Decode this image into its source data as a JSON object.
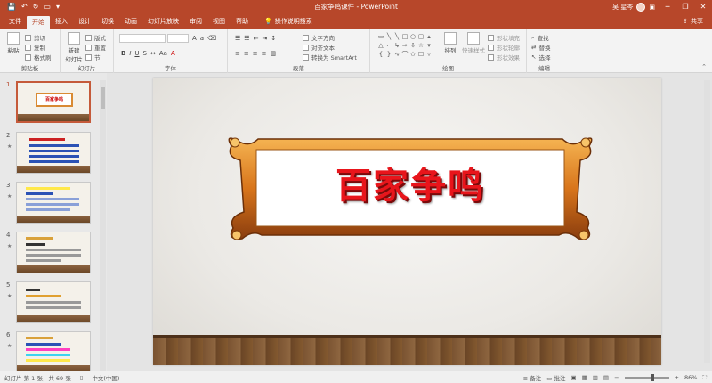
{
  "window": {
    "title": "百家争鸣课件 - PowerPoint",
    "user": "吴 星岑",
    "share": "共享"
  },
  "tabs": [
    {
      "label": "文件",
      "active": false
    },
    {
      "label": "开始",
      "active": true
    },
    {
      "label": "插入",
      "active": false
    },
    {
      "label": "设计",
      "active": false
    },
    {
      "label": "切换",
      "active": false
    },
    {
      "label": "动画",
      "active": false
    },
    {
      "label": "幻灯片放映",
      "active": false
    },
    {
      "label": "审阅",
      "active": false
    },
    {
      "label": "视图",
      "active": false
    },
    {
      "label": "帮助",
      "active": false
    }
  ],
  "tell_me": "操作说明搜索",
  "ribbon": {
    "clipboard": {
      "label": "剪贴板",
      "paste": "粘贴",
      "cut": "剪切",
      "copy": "复制",
      "format_painter": "格式刷"
    },
    "slides": {
      "label": "幻灯片",
      "new_slide": "新建\n幻灯片",
      "layout": "版式",
      "reset": "重置",
      "section": "节"
    },
    "font": {
      "label": "字体"
    },
    "paragraph": {
      "label": "段落",
      "text_direction": "文字方向",
      "align_text": "对齐文本",
      "smartart": "转换为 SmartArt"
    },
    "drawing": {
      "label": "绘图",
      "arrange": "排列",
      "quick_styles": "快速样式",
      "fill": "形状填充",
      "outline": "形状轮廓",
      "effects": "形状效果"
    },
    "editing": {
      "label": "编辑",
      "find": "查找",
      "replace": "替换",
      "select": "选择"
    }
  },
  "slide": {
    "title": "百家争鸣"
  },
  "thumbnails": [
    {
      "num": "1",
      "star": ""
    },
    {
      "num": "2",
      "star": "★"
    },
    {
      "num": "3",
      "star": "★"
    },
    {
      "num": "4",
      "star": "★"
    },
    {
      "num": "5",
      "star": "★"
    },
    {
      "num": "6",
      "star": "★"
    }
  ],
  "thumb_text": {
    "t1": "百家争鸣"
  },
  "status": {
    "slide_info": "幻灯片 第 1 张，共 69 张",
    "language": "中文(中国)",
    "notes": "备注",
    "comments": "批注",
    "zoom": "86%"
  },
  "colors": {
    "accent": "#b7472a",
    "title_red": "#e8151b",
    "frame_orange": "#e08a2a"
  }
}
